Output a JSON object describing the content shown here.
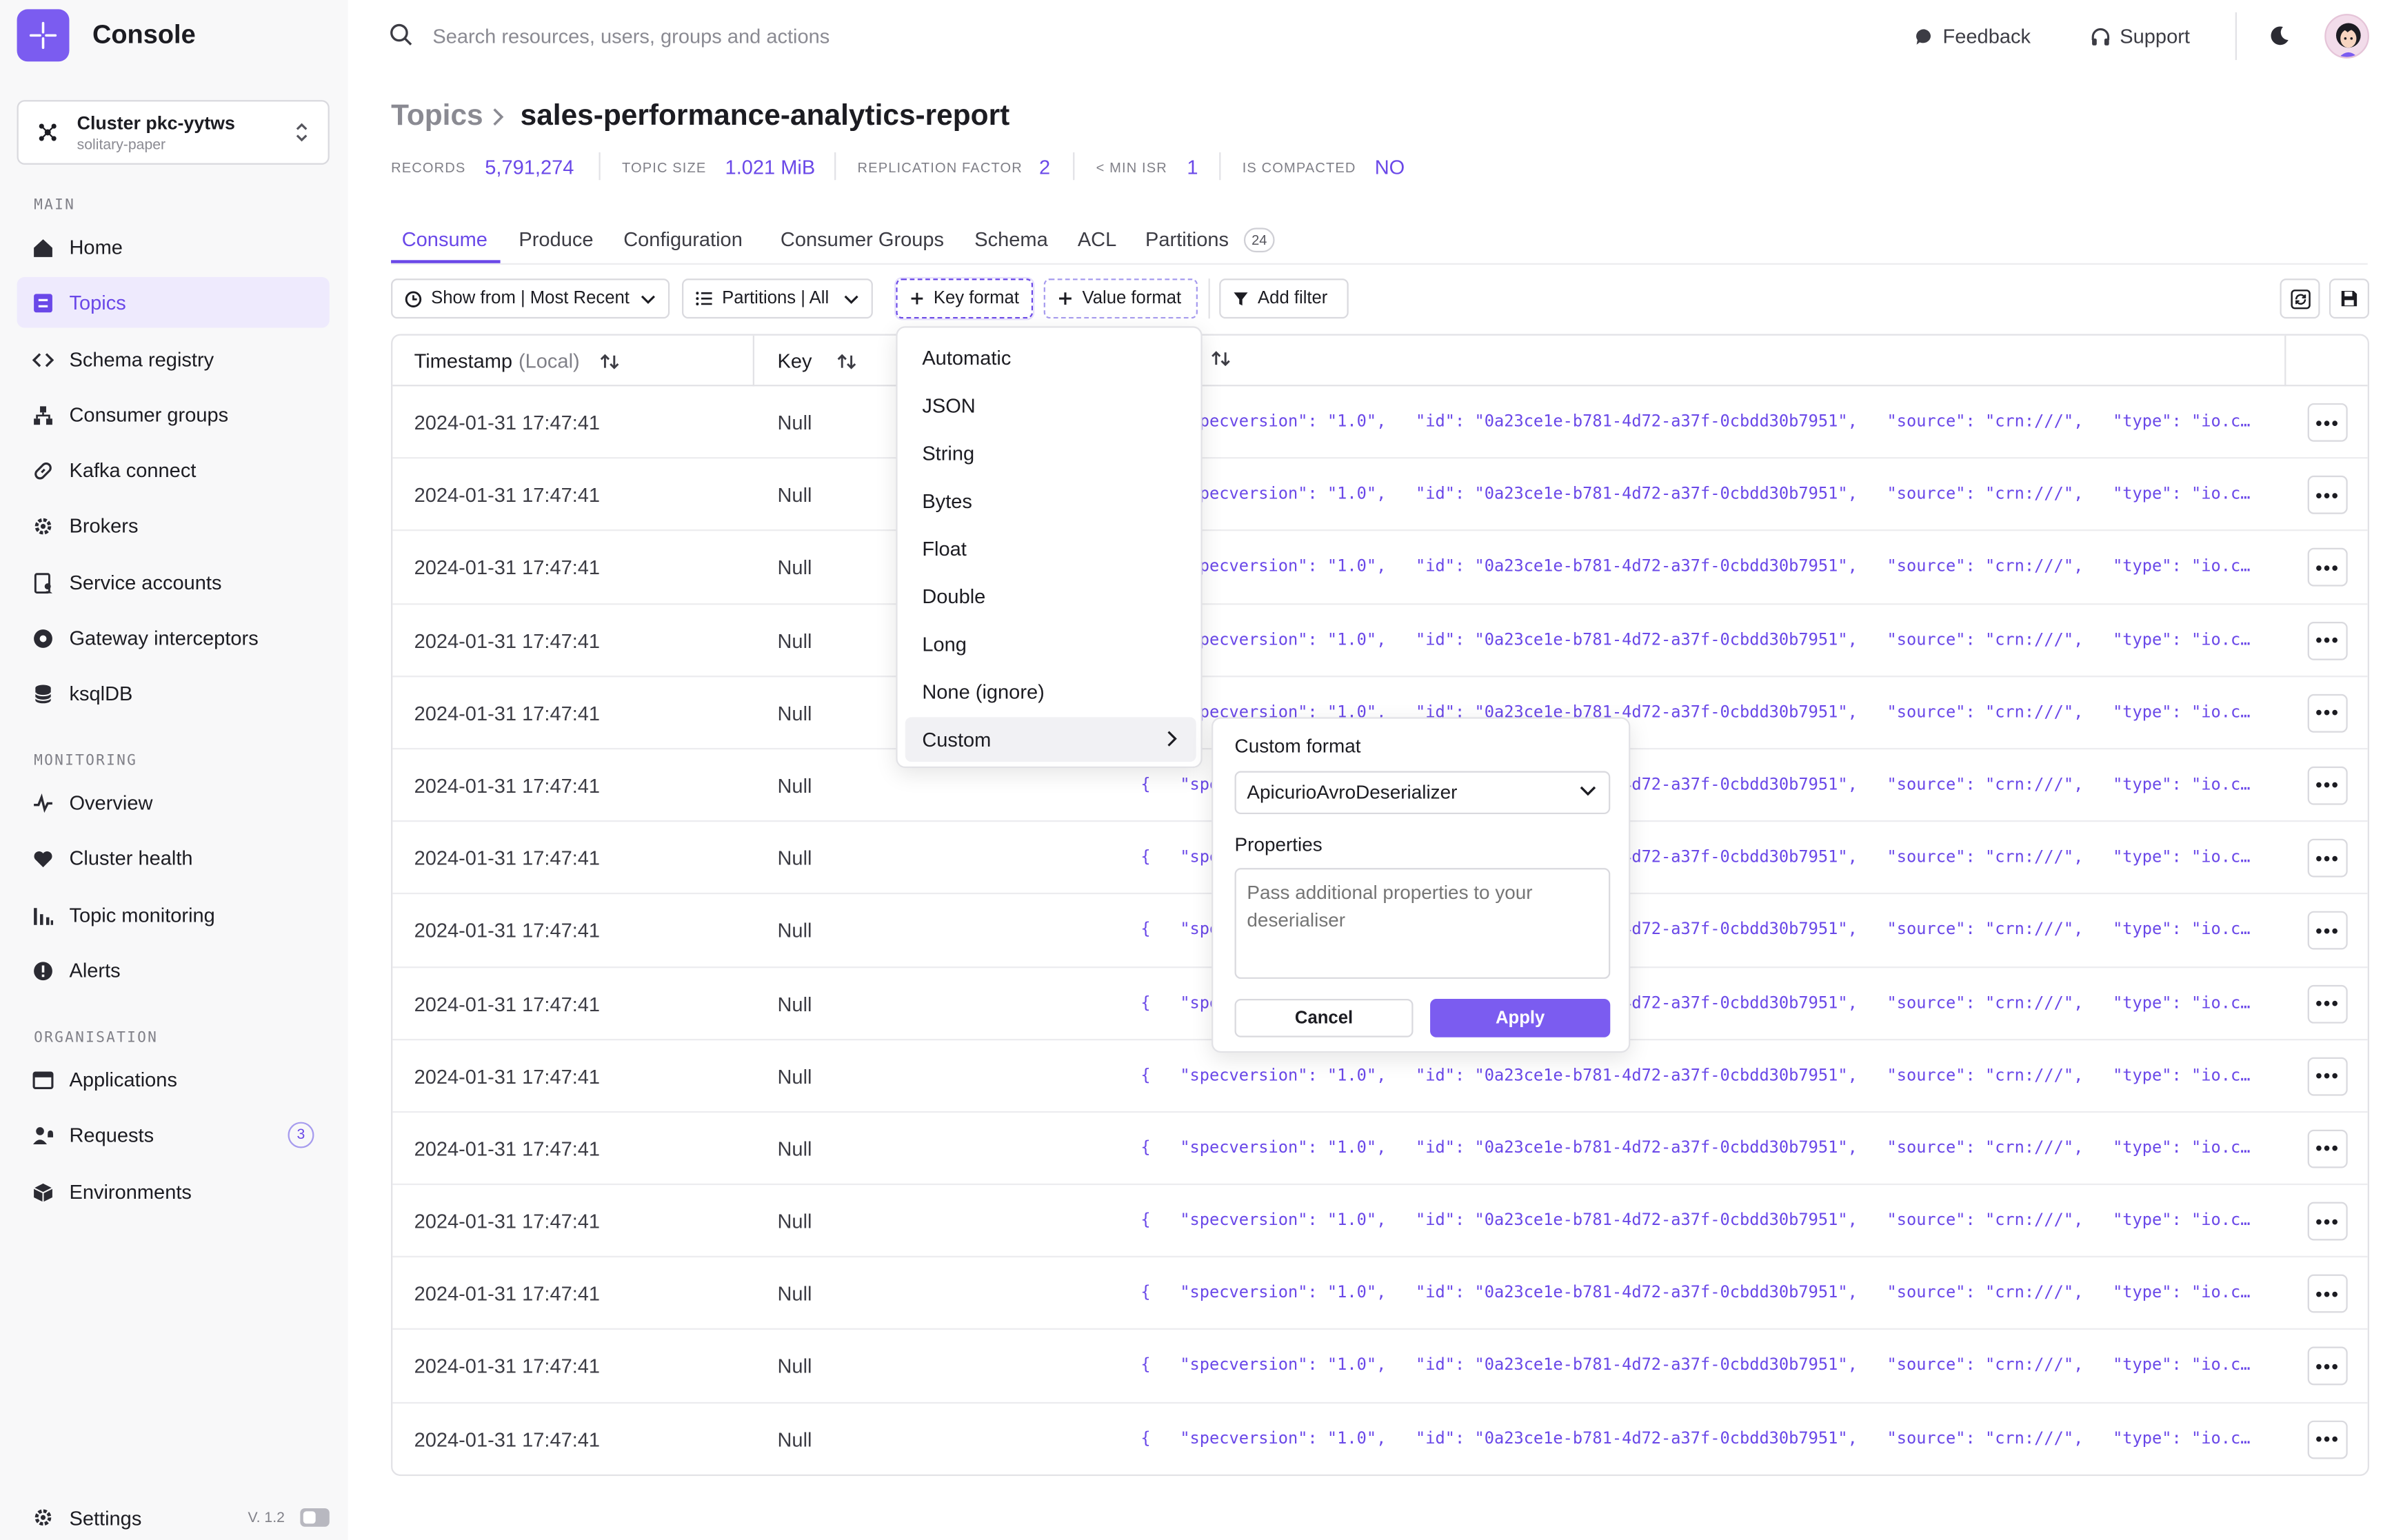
{
  "app": {
    "title": "Console"
  },
  "cluster": {
    "name": "Cluster pkc-yytws",
    "subtitle": "solitary-paper"
  },
  "sidebar": {
    "sections": {
      "main": "MAIN",
      "monitoring": "MONITORING",
      "organisation": "ORGANISATION"
    },
    "main_items": [
      {
        "label": "Home",
        "icon": "home-icon"
      },
      {
        "label": "Topics",
        "icon": "list-icon",
        "active": true
      },
      {
        "label": "Schema registry",
        "icon": "code-icon"
      },
      {
        "label": "Consumer groups",
        "icon": "hierarchy-icon"
      },
      {
        "label": "Kafka connect",
        "icon": "link-icon"
      },
      {
        "label": "Brokers",
        "icon": "cog-icon"
      },
      {
        "label": "Service accounts",
        "icon": "document-user-icon"
      },
      {
        "label": "Gateway interceptors",
        "icon": "gateway-icon"
      },
      {
        "label": "ksqlDB",
        "icon": "database-icon"
      }
    ],
    "monitoring_items": [
      {
        "label": "Overview",
        "icon": "activity-icon"
      },
      {
        "label": "Cluster health",
        "icon": "heart-icon"
      },
      {
        "label": "Topic monitoring",
        "icon": "bar-chart-icon"
      },
      {
        "label": "Alerts",
        "icon": "alert-icon"
      }
    ],
    "organisation_items": [
      {
        "label": "Applications",
        "icon": "window-icon"
      },
      {
        "label": "Requests",
        "icon": "user-bell-icon",
        "badge": "3"
      },
      {
        "label": "Environments",
        "icon": "cube-icon"
      }
    ],
    "settings": {
      "label": "Settings",
      "version": "V. 1.2"
    }
  },
  "topbar": {
    "search_placeholder": "Search resources, users, groups and actions",
    "feedback": "Feedback",
    "support": "Support"
  },
  "header": {
    "breadcrumb_root": "Topics",
    "topic_name": "sales-performance-analytics-report",
    "stats": [
      {
        "label": "RECORDS",
        "value": "5,791,274"
      },
      {
        "label": "TOPIC SIZE",
        "value": "1.021 MiB"
      },
      {
        "label": "REPLICATION FACTOR",
        "value": "2"
      },
      {
        "label": "< MIN ISR",
        "value": "1"
      },
      {
        "label": "IS COMPACTED",
        "value": "NO"
      }
    ]
  },
  "tabs": [
    {
      "label": "Consume",
      "active": true
    },
    {
      "label": "Produce"
    },
    {
      "label": "Configuration"
    },
    {
      "label": "Consumer Groups"
    },
    {
      "label": "Schema"
    },
    {
      "label": "ACL"
    },
    {
      "label": "Partitions",
      "count": "24"
    }
  ],
  "toolbar": {
    "show_from": "Show from | Most Recent",
    "partitions": "Partitions | All",
    "key_format": "Key format",
    "value_format": "Value format",
    "add_filter": "Add filter"
  },
  "table": {
    "columns": {
      "timestamp": "Timestamp",
      "timestamp_sub": "(Local)",
      "key": "Key"
    },
    "rows": [
      {
        "timestamp": "2024-01-31 17:47:41",
        "key": "Null",
        "value": "{   \"specversion\": \"1.0\",   \"id\": \"0a23ce1e-b781-4d72-a37f-0cbdd30b7951\",   \"source\": \"crn:///\",   \"type\": \"io.con…"
      },
      {
        "timestamp": "2024-01-31 17:47:41",
        "key": "Null",
        "value": "{   \"specversion\": \"1.0\",   \"id\": \"0a23ce1e-b781-4d72-a37f-0cbdd30b7951\",   \"source\": \"crn:///\",   \"type\": \"io.con…"
      },
      {
        "timestamp": "2024-01-31 17:47:41",
        "key": "Null",
        "value": "{   \"specversion\": \"1.0\",   \"id\": \"0a23ce1e-b781-4d72-a37f-0cbdd30b7951\",   \"source\": \"crn:///\",   \"type\": \"io.con…"
      },
      {
        "timestamp": "2024-01-31 17:47:41",
        "key": "Null",
        "value": "{   \"specversion\": \"1.0\",   \"id\": \"0a23ce1e-b781-4d72-a37f-0cbdd30b7951\",   \"source\": \"crn:///\",   \"type\": \"io.con…"
      },
      {
        "timestamp": "2024-01-31 17:47:41",
        "key": "Null",
        "value": "{   \"specversion\": \"1.0\",   \"id\": \"0a23ce1e-b781-4d72-a37f-0cbdd30b7951\",   \"source\": \"crn:///\",   \"type\": \"io.con…"
      },
      {
        "timestamp": "2024-01-31 17:47:41",
        "key": "Null",
        "value": "{   \"specversion\": \"1.0\",   \"id\": \"0a23ce1e-b781-4d72-a37f-0cbdd30b7951\",   \"source\": \"crn:///\",   \"type\": \"io.con…"
      },
      {
        "timestamp": "2024-01-31 17:47:41",
        "key": "Null",
        "value": "{   \"specversion\": \"1.0\",   \"id\": \"0a23ce1e-b781-4d72-a37f-0cbdd30b7951\",   \"source\": \"crn:///\",   \"type\": \"io.con…"
      },
      {
        "timestamp": "2024-01-31 17:47:41",
        "key": "Null",
        "value": "{   \"specversion\": \"1.0\",   \"id\": \"0a23ce1e-b781-4d72-a37f-0cbdd30b7951\",   \"source\": \"crn:///\",   \"type\": \"io.con…"
      },
      {
        "timestamp": "2024-01-31 17:47:41",
        "key": "Null",
        "value": "{   \"specversion\": \"1.0\",   \"id\": \"0a23ce1e-b781-4d72-a37f-0cbdd30b7951\",   \"source\": \"crn:///\",   \"type\": \"io.con…"
      },
      {
        "timestamp": "2024-01-31 17:47:41",
        "key": "Null",
        "value": "{   \"specversion\": \"1.0\",   \"id\": \"0a23ce1e-b781-4d72-a37f-0cbdd30b7951\",   \"source\": \"crn:///\",   \"type\": \"io.con…"
      },
      {
        "timestamp": "2024-01-31 17:47:41",
        "key": "Null",
        "value": "{   \"specversion\": \"1.0\",   \"id\": \"0a23ce1e-b781-4d72-a37f-0cbdd30b7951\",   \"source\": \"crn:///\",   \"type\": \"io.con…"
      },
      {
        "timestamp": "2024-01-31 17:47:41",
        "key": "Null",
        "value": "{   \"specversion\": \"1.0\",   \"id\": \"0a23ce1e-b781-4d72-a37f-0cbdd30b7951\",   \"source\": \"crn:///\",   \"type\": \"io.con…"
      },
      {
        "timestamp": "2024-01-31 17:47:41",
        "key": "Null",
        "value": "{   \"specversion\": \"1.0\",   \"id\": \"0a23ce1e-b781-4d72-a37f-0cbdd30b7951\",   \"source\": \"crn:///\",   \"type\": \"io.con…"
      },
      {
        "timestamp": "2024-01-31 17:47:41",
        "key": "Null",
        "value": "{   \"specversion\": \"1.0\",   \"id\": \"0a23ce1e-b781-4d72-a37f-0cbdd30b7951\",   \"source\": \"crn:///\",   \"type\": \"io.con…"
      },
      {
        "timestamp": "2024-01-31 17:47:41",
        "key": "Null",
        "value": "{   \"specversion\": \"1.0\",   \"id\": \"0a23ce1e-b781-4d72-a37f-0cbdd30b7951\",   \"source\": \"crn:///\",   \"type\": \"io.con…"
      }
    ]
  },
  "key_format_menu": {
    "options": [
      "Automatic",
      "JSON",
      "String",
      "Bytes",
      "Float",
      "Double",
      "Long",
      "None (ignore)",
      "Custom"
    ],
    "highlighted": "Custom"
  },
  "custom_format": {
    "title": "Custom format",
    "selected_deserializer": "ApicurioAvroDeserializer",
    "properties_label": "Properties",
    "properties_placeholder": "Pass additional properties to your deserialiser",
    "cancel_label": "Cancel",
    "apply_label": "Apply"
  },
  "colors": {
    "accent": "#7b5cf0",
    "accent_text": "#6a48e8",
    "sidebar_bg": "#f8f8f9",
    "active_nav_bg": "#eeeafd"
  }
}
